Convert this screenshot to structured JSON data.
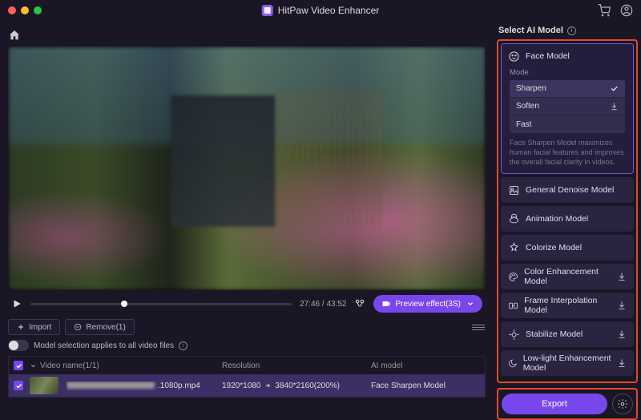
{
  "titlebar": {
    "title": "HitPaw Video Enhancer"
  },
  "controls": {
    "time": "27:46 / 43:52",
    "preview_effect_label": "Preview effect(3S)"
  },
  "actions": {
    "import_label": "Import",
    "remove_label": "Remove(1)"
  },
  "toggle": {
    "label": "Model selection applies to all video files"
  },
  "table": {
    "headers": {
      "name": "Video name(1/1)",
      "resolution": "Resolution",
      "model": "AI model"
    },
    "rows": [
      {
        "filename_suffix": ".1080p.mp4",
        "res_from": "1920*1080",
        "res_to": "3840*2160(200%)",
        "model": "Face Sharpen Model"
      }
    ]
  },
  "panel": {
    "title": "Select AI Model",
    "face": {
      "label": "Face Model",
      "mode_label": "Mode",
      "options": {
        "sharpen": "Sharpen",
        "soften": "Soften",
        "fast": "Fast"
      },
      "desc": "Face Sharpen Model maximizes human facial features and improves the overall facial clarity in videos."
    },
    "models": {
      "denoise": "General Denoise Model",
      "animation": "Animation Model",
      "colorize": "Colorize Model",
      "color_enh": "Color Enhancement Model",
      "frame_interp": "Frame Interpolation Model",
      "stabilize": "Stabilize Model",
      "lowlight": "Low-light Enhancement Model"
    }
  },
  "export": {
    "label": "Export"
  },
  "colors": {
    "accent": "#7847eb",
    "highlight_border": "#e04a2a"
  }
}
